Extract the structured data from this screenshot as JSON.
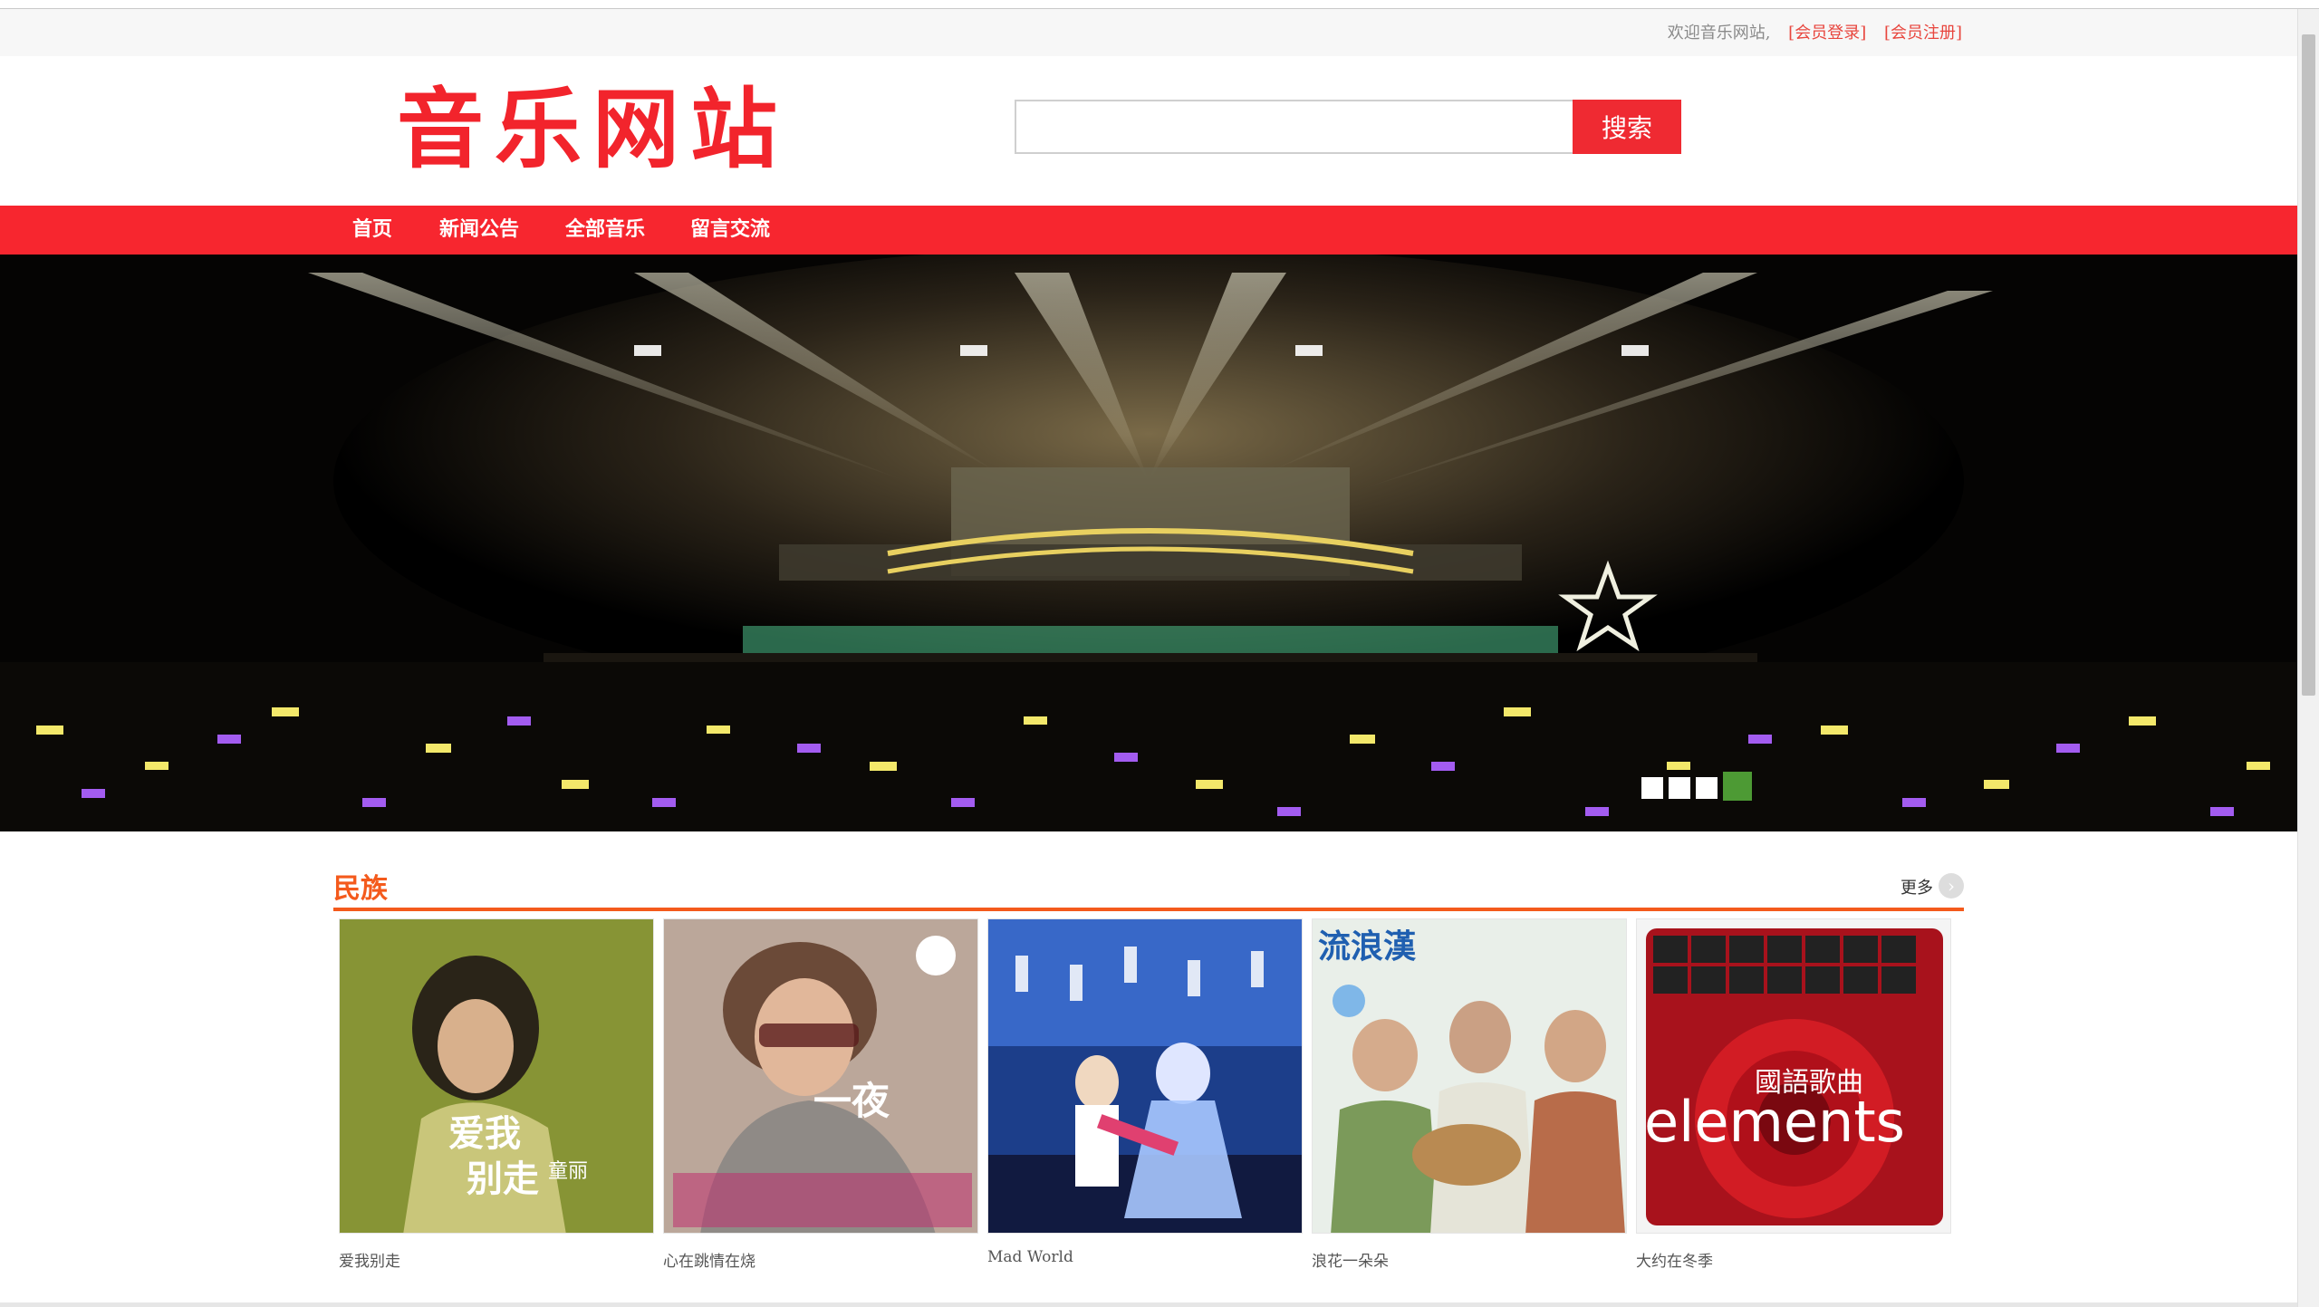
{
  "topbar": {
    "welcome": "欢迎音乐网站,",
    "login": "[会员登录]",
    "register": "[会员注册]"
  },
  "header": {
    "logo": "音乐网站",
    "search": {
      "placeholder": "",
      "button": "搜索"
    }
  },
  "nav": {
    "items": [
      "首页",
      "新闻公告",
      "全部音乐",
      "留言交流"
    ]
  },
  "banner": {
    "slides": 4,
    "active_slide": 4,
    "active_color": "#4d9a34"
  },
  "section": {
    "title": "民族",
    "more": "更多",
    "albums": [
      {
        "name": "爱我别走",
        "cover_text": "爱我别走 童丽"
      },
      {
        "name": "心在跳情在烧",
        "cover_text": "一夜"
      },
      {
        "name": "Mad World",
        "cover_text": ""
      },
      {
        "name": "浪花一朵朵",
        "cover_text": "流浪漢"
      },
      {
        "name": "大约在冬季",
        "cover_text": "國語歌曲 elements"
      }
    ]
  },
  "colors": {
    "brand_red": "#f7262f",
    "section_orange": "#f45a1c"
  }
}
